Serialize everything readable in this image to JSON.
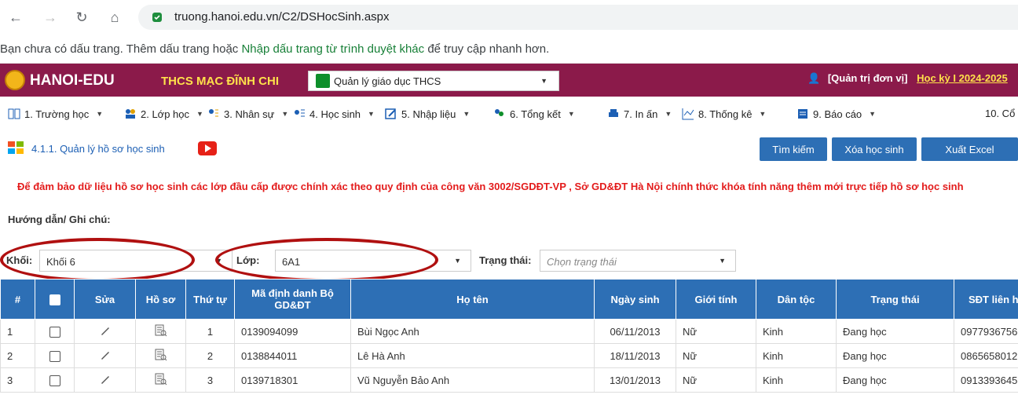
{
  "browser": {
    "url": "truong.hanoi.edu.vn/C2/DSHocSinh.aspx",
    "bookmark_prefix": "Bạn chưa có dấu trang. Thêm dấu trang hoặc ",
    "bookmark_link": "Nhập dấu trang từ trình duyệt khác",
    "bookmark_suffix": " để truy cập nhanh hơn."
  },
  "header": {
    "brand": "HANOI-EDU",
    "school": "THCS MẠC ĐĨNH CHI",
    "system_select": "Quản lý giáo dục THCS",
    "user_role": "[Quản trị đơn vị]",
    "term": "Học kỳ I 2024-2025"
  },
  "menu": [
    "1. Trường học",
    "2. Lớp học",
    "3. Nhân sự",
    "4. Học sinh",
    "5. Nhập liệu",
    "6. Tổng kết",
    "7. In ấn",
    "8. Thống kê",
    "9. Báo cáo",
    "10. Cổ"
  ],
  "page": {
    "title": "4.1.1. Quản lý hồ sơ học sinh",
    "buttons": {
      "search": "Tìm kiếm",
      "delete": "Xóa học sinh",
      "export": "Xuất Excel"
    },
    "notice": "Để đảm bảo dữ liệu hồ sơ học sinh các lớp đầu cấp được chính xác theo quy định của công văn 3002/SGDĐT-VP , Sở GD&ĐT Hà Nội chính thức khóa tính năng thêm mới trực tiếp hồ sơ học sinh",
    "guide": "Hướng dẫn/ Ghi chú:"
  },
  "filters": {
    "khoi_label": "Khối:",
    "khoi_value": "Khối 6",
    "lop_label": "Lớp:",
    "lop_value": "6A1",
    "trangthai_label": "Trạng thái:",
    "trangthai_placeholder": "Chọn trạng thái"
  },
  "table": {
    "headers": [
      "#",
      "",
      "Sửa",
      "Hồ sơ",
      "Thứ tự",
      "Mã định danh Bộ GD&ĐT",
      "Họ tên",
      "Ngày sinh",
      "Giới tính",
      "Dân tộc",
      "Trạng thái",
      "SĐT liên hệ"
    ],
    "rows": [
      {
        "no": "1",
        "order": "1",
        "id": "0139094099",
        "name": "Bùi Ngọc Anh",
        "dob": "06/11/2013",
        "gender": "Nữ",
        "ethnic": "Kinh",
        "status": "Đang học",
        "phone": "0977936756"
      },
      {
        "no": "2",
        "order": "2",
        "id": "0138844011",
        "name": "Lê Hà Anh",
        "dob": "18/11/2013",
        "gender": "Nữ",
        "ethnic": "Kinh",
        "status": "Đang học",
        "phone": "0865658012"
      },
      {
        "no": "3",
        "order": "3",
        "id": "0139718301",
        "name": "Vũ Nguyễn Bảo Anh",
        "dob": "13/01/2013",
        "gender": "Nữ",
        "ethnic": "Kinh",
        "status": "Đang học",
        "phone": "0913393645"
      }
    ]
  }
}
